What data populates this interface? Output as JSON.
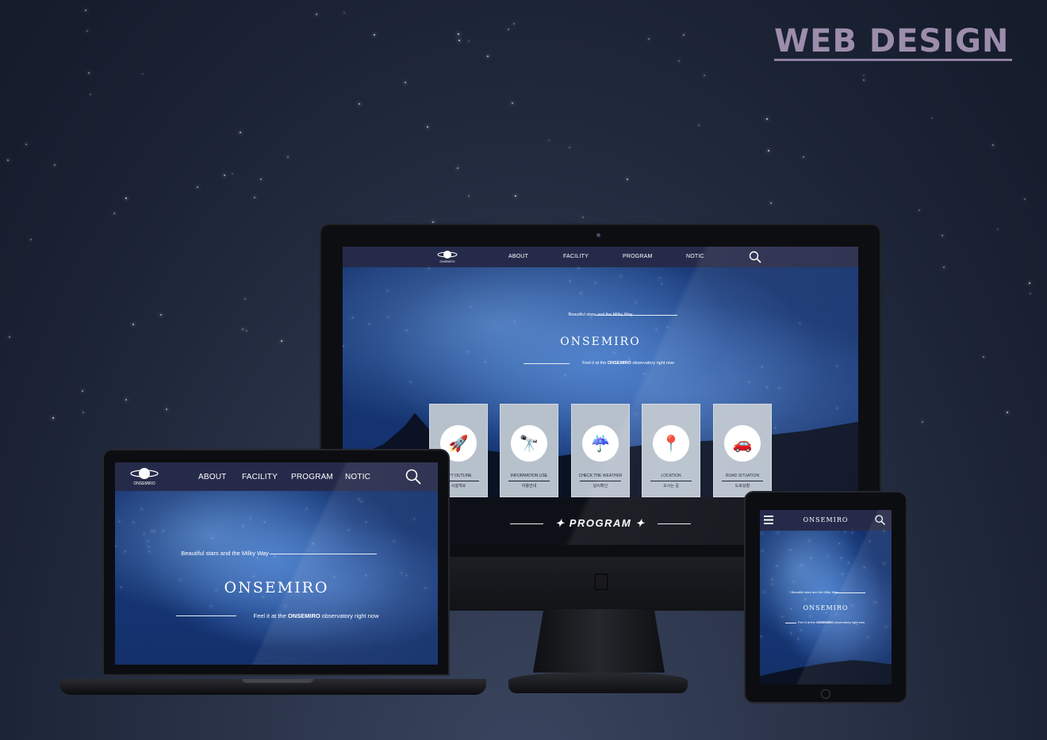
{
  "heading": {
    "title": "WEB DESIGN"
  },
  "site": {
    "logo_text": "ONSEMIRO",
    "nav": [
      "ABOUT",
      "FACILITY",
      "PROGRAM",
      "NOTIC"
    ],
    "hero": {
      "kicker": "Beautiful stars and the Milky Way",
      "title": "ONSEMIRO",
      "tagline_pre": "Feel it at the ",
      "tagline_brand": "ONSEMIRO",
      "tagline_post": " observatory right now"
    },
    "cards": [
      {
        "label": "LITY OUTLINE",
        "sub": "시설개요",
        "icon": "rocket-icon"
      },
      {
        "label": "INFORMATION USE",
        "sub": "이용안내",
        "icon": "telescope-icon"
      },
      {
        "label": "CHECK THE WEATHER",
        "sub": "날씨확인",
        "icon": "weather-icon"
      },
      {
        "label": "LOCATION",
        "sub": "오시는 길",
        "icon": "location-icon"
      },
      {
        "label": "ROAD SITUATION",
        "sub": "도로상황",
        "icon": "car-icon"
      }
    ],
    "program_heading": "PROGRAM"
  },
  "colors": {
    "title": "#9d8dac",
    "nav_bg": "#262a4a",
    "card_bg": "#b7c1cc",
    "background": "#1a2234"
  }
}
